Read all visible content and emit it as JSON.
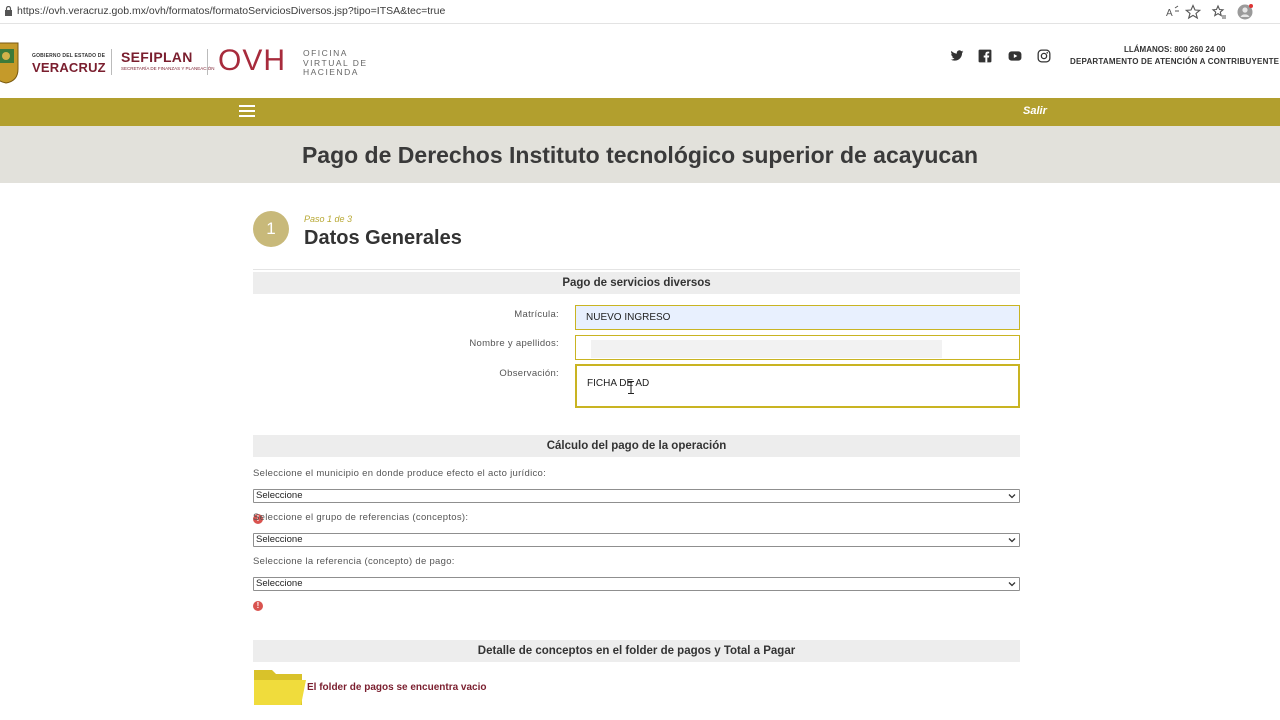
{
  "browser": {
    "url": "https://ovh.veracruz.gob.mx/ovh/formatos/formatoServiciosDiversos.jsp?tipo=ITSA&tec=true",
    "icons": [
      "read-aloud-icon",
      "favorite-star-icon",
      "favorites-icon",
      "profile-icon"
    ]
  },
  "header": {
    "gov_small": "GOBIERNO DEL ESTADO DE",
    "gov_big": "VERACRUZ",
    "sefiplan_big": "SEFIPLAN",
    "sefiplan_small": "SECRETARÍA DE FINANZAS Y PLANEACIÓN",
    "ovh": "OVH",
    "ovh_sub1": "OFICINA",
    "ovh_sub2": "VIRTUAL DE",
    "ovh_sub3": "HACIENDA",
    "social": [
      "twitter-icon",
      "facebook-icon",
      "youtube-icon",
      "instagram-icon"
    ],
    "call_label": "LLÁMANOS:",
    "call_number": "800 260 24 00",
    "department": "DEPARTAMENTO DE ATENCIÓN A CONTRIBUYENTE"
  },
  "nav": {
    "logout": "Salir"
  },
  "page": {
    "title": "Pago de Derechos Instituto tecnológico superior de acayucan"
  },
  "step": {
    "number": "1",
    "label": "Paso 1 de 3",
    "title": "Datos Generales"
  },
  "section1": {
    "title": "Pago de servicios diversos",
    "matricula_label": "Matrícula:",
    "matricula_value": "NUEVO INGRESO",
    "nombre_label": "Nombre y apellidos:",
    "nombre_value": "",
    "observacion_label": "Observación:",
    "observacion_value": "FICHA DE AD"
  },
  "section2": {
    "title": "Cálculo del pago de la operación",
    "q1": "Seleccione el municipio en donde produce efecto el acto jurídico:",
    "q1_value": "Seleccione",
    "q2": "Seleccione el grupo de referencias (conceptos):",
    "q2_value": "Seleccione",
    "q3": "Seleccione la referencia (concepto) de pago:",
    "q3_value": "Seleccione",
    "error_glyph": "!"
  },
  "section3": {
    "title": "Detalle de conceptos en el folder de pagos y Total a Pagar",
    "empty_msg": "El folder de pagos se encuentra vacio"
  },
  "colors": {
    "gold": "#b29f2e",
    "wine": "#7a1e2e",
    "ovh_red": "#a72b3c",
    "title_band": "#e2e1db",
    "step_circle": "#c8b97a"
  }
}
